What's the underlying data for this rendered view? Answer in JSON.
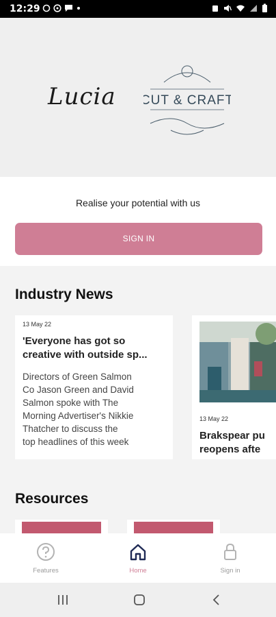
{
  "status_bar": {
    "time": "12:29"
  },
  "hero": {
    "logo_left": "Lucia",
    "logo_right_top": "CUT & CRAFT"
  },
  "signin": {
    "tagline": "Realise your potential with us",
    "button": "SIGN IN"
  },
  "news": {
    "title": "Industry News",
    "cards": [
      {
        "date": "13 May 22",
        "title_l1": "'Everyone has got so",
        "title_l2": "creative with outside sp...",
        "desc": [
          "Directors of Green Salmon",
          "Co Jason Green and David",
          "Salmon spoke with The",
          "Morning Advertiser's Nikkie",
          "Thatcher to discuss the",
          "top headlines of this week"
        ]
      },
      {
        "date": "13 May 22",
        "title_l1": "Brakspear pu",
        "title_l2": "reopens afte"
      }
    ]
  },
  "resources": {
    "title": "Resources"
  },
  "bottom_nav": {
    "features": "Features",
    "home": "Home",
    "signin": "Sign in"
  },
  "colors": {
    "accent": "#cf7e95",
    "nav_active": "#1f2a55",
    "home_label": "#cf7e95"
  }
}
